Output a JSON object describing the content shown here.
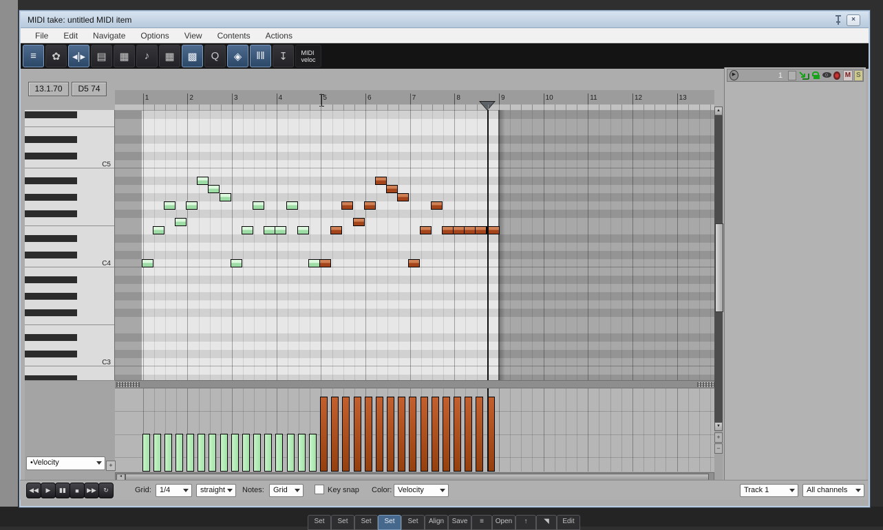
{
  "window": {
    "title": "MIDI take: untitled MIDI item",
    "close_glyph": "×"
  },
  "menu": {
    "items": [
      "File",
      "Edit",
      "Navigate",
      "Options",
      "View",
      "Contents",
      "Actions"
    ]
  },
  "toolbar": {
    "buttons": [
      {
        "name": "piano-roll-view-button",
        "glyph": "≡",
        "active": true
      },
      {
        "name": "note-color-button",
        "glyph": "✿",
        "active": false
      },
      {
        "name": "center-view-button",
        "glyph": "◂|▸",
        "active": true
      },
      {
        "name": "event-list-button",
        "glyph": "▤",
        "active": false
      },
      {
        "name": "event-properties-button",
        "glyph": "▦",
        "active": false
      },
      {
        "name": "notation-view-button",
        "glyph": "♪",
        "active": false
      },
      {
        "name": "step-input-button",
        "glyph": "▦",
        "active": false
      },
      {
        "name": "grid-rows-button",
        "glyph": "▩",
        "active": true
      },
      {
        "name": "quantize-button",
        "glyph": "Q",
        "active": false
      },
      {
        "name": "humanize-button",
        "glyph": "◈",
        "active": true
      },
      {
        "name": "vertical-bars-button",
        "glyph": "‖‖",
        "active": true
      },
      {
        "name": "dock-button",
        "glyph": "↧",
        "active": false
      }
    ],
    "midi_veloc_label": "MIDI veloc"
  },
  "status": {
    "position": "13.1.70",
    "note": "D5  74"
  },
  "ruler": {
    "measures": [
      "1",
      "2",
      "3",
      "4",
      "5",
      "6",
      "7",
      "8",
      "9",
      "10",
      "11",
      "12",
      "13"
    ]
  },
  "keyboard": {
    "octave_labels": [
      "C5",
      "C4",
      "C3"
    ]
  },
  "chart_data": {
    "type": "piano-roll",
    "title": "MIDI take: untitled MIDI item",
    "grid": "1/4 straight",
    "colors": {
      "green": "#a9e2ad",
      "orange": "#b1512a"
    },
    "velocity_levels": {
      "green": 60,
      "orange": 120
    },
    "notes": [
      {
        "pitch": "C4",
        "beat": 0,
        "color": "green",
        "velocity": 60
      },
      {
        "pitch": "E4",
        "beat": 1,
        "color": "green",
        "velocity": 60
      },
      {
        "pitch": "G4",
        "beat": 2,
        "color": "green",
        "velocity": 60
      },
      {
        "pitch": "F4",
        "beat": 3,
        "color": "green",
        "velocity": 60
      },
      {
        "pitch": "G4",
        "beat": 4,
        "color": "green",
        "velocity": 60
      },
      {
        "pitch": "A#4",
        "beat": 5,
        "color": "green",
        "velocity": 60
      },
      {
        "pitch": "A4",
        "beat": 6,
        "color": "green",
        "velocity": 60
      },
      {
        "pitch": "G#4",
        "beat": 7,
        "color": "green",
        "velocity": 60
      },
      {
        "pitch": "C4",
        "beat": 8,
        "color": "green",
        "velocity": 60
      },
      {
        "pitch": "E4",
        "beat": 9,
        "color": "green",
        "velocity": 60
      },
      {
        "pitch": "G4",
        "beat": 10,
        "color": "green",
        "velocity": 60
      },
      {
        "pitch": "E4",
        "beat": 11,
        "color": "green",
        "velocity": 60
      },
      {
        "pitch": "E4",
        "beat": 12,
        "color": "green",
        "velocity": 60
      },
      {
        "pitch": "G4",
        "beat": 13,
        "color": "green",
        "velocity": 60
      },
      {
        "pitch": "E4",
        "beat": 14,
        "color": "green",
        "velocity": 60
      },
      {
        "pitch": "C4",
        "beat": 15,
        "color": "green",
        "velocity": 60
      },
      {
        "pitch": "C4",
        "beat": 16,
        "color": "orange",
        "velocity": 120
      },
      {
        "pitch": "E4",
        "beat": 17,
        "color": "orange",
        "velocity": 120
      },
      {
        "pitch": "G4",
        "beat": 18,
        "color": "orange",
        "velocity": 120
      },
      {
        "pitch": "F4",
        "beat": 19,
        "color": "orange",
        "velocity": 120
      },
      {
        "pitch": "G4",
        "beat": 20,
        "color": "orange",
        "velocity": 120
      },
      {
        "pitch": "A#4",
        "beat": 21,
        "color": "orange",
        "velocity": 120
      },
      {
        "pitch": "A4",
        "beat": 22,
        "color": "orange",
        "velocity": 120
      },
      {
        "pitch": "G#4",
        "beat": 23,
        "color": "orange",
        "velocity": 120
      },
      {
        "pitch": "C4",
        "beat": 24,
        "color": "orange",
        "velocity": 120
      },
      {
        "pitch": "E4",
        "beat": 25,
        "color": "orange",
        "velocity": 120
      },
      {
        "pitch": "G4",
        "beat": 26,
        "color": "orange",
        "velocity": 120
      },
      {
        "pitch": "E4",
        "beat": 27,
        "color": "orange",
        "velocity": 120
      },
      {
        "pitch": "E4",
        "beat": 28,
        "color": "orange",
        "velocity": 120
      },
      {
        "pitch": "E4",
        "beat": 29,
        "color": "orange",
        "velocity": 120
      },
      {
        "pitch": "E4",
        "beat": 30,
        "color": "orange",
        "velocity": 120
      },
      {
        "pitch": "E4",
        "beat": 31,
        "color": "orange",
        "velocity": 120
      }
    ]
  },
  "velocity_lane": {
    "selected_cc": "•Velocity",
    "add_lane_label": "+"
  },
  "transport": {
    "buttons": [
      {
        "name": "rewind-button",
        "glyph": "◀◀"
      },
      {
        "name": "play-button",
        "glyph": "▶"
      },
      {
        "name": "pause-button",
        "glyph": "▮▮"
      },
      {
        "name": "stop-button",
        "glyph": "■"
      },
      {
        "name": "forward-button",
        "glyph": "▶▶"
      },
      {
        "name": "loop-button",
        "glyph": "↻"
      }
    ]
  },
  "controls": {
    "grid_label": "Grid:",
    "grid_value": "1/4",
    "swing_value": "straight",
    "notes_label": "Notes:",
    "notes_value": "Grid",
    "key_snap_label": "Key snap",
    "color_label": "Color:",
    "color_value": "Velocity"
  },
  "track_panel": {
    "number": "1",
    "mute": "M",
    "solo": "S"
  },
  "footer": {
    "track": "Track 1",
    "channels": "All channels"
  },
  "background_toolbar": {
    "buttons": [
      {
        "label": "Set"
      },
      {
        "label": "Set"
      },
      {
        "label": "Set"
      },
      {
        "label": "Set",
        "active": true
      },
      {
        "label": "Set"
      },
      {
        "label": "Align"
      },
      {
        "label": "Save"
      },
      {
        "label": "≡",
        "icon": "menu-icon"
      },
      {
        "label": "Open"
      },
      {
        "label": "↑",
        "icon": "up-arrow-icon"
      },
      {
        "label": "◥",
        "icon": "pan-icon"
      },
      {
        "label": "Edit"
      }
    ]
  }
}
